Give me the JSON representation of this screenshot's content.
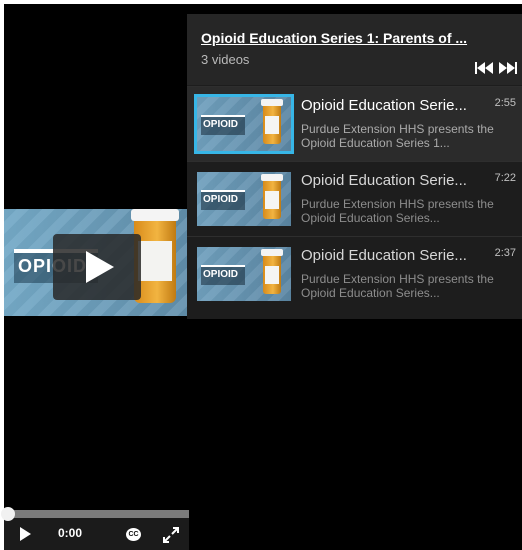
{
  "player": {
    "current_time": "0:00",
    "cc_label": "CC",
    "progress_fraction": 0
  },
  "playlist": {
    "title": "Opioid Education Series 1: Parents of ...",
    "count": "3 videos",
    "items": [
      {
        "title": "Opioid Education Serie...",
        "duration": "2:55",
        "description": "Purdue Extension HHS presents the Opioid Education Series 1...",
        "thumb_text": "OPIOID",
        "active": true
      },
      {
        "title": "Opioid Education Serie...",
        "duration": "7:22",
        "description": "Purdue Extension HHS presents the Opioid Education Series...",
        "thumb_text": "OPIOID",
        "active": false
      },
      {
        "title": "Opioid Education Serie...",
        "duration": "2:37",
        "description": "Purdue Extension HHS presents the Opioid Education Series...",
        "thumb_text": "OPIOID",
        "active": false
      }
    ]
  },
  "video": {
    "thumb_text": "OPIOID"
  },
  "colors": {
    "background": "#000000",
    "playlist_bg": "#1d1d1d",
    "active_thumb_outline": "#37b6e7"
  },
  "icons": {
    "play": "play-icon",
    "prev": "previous-track-icon",
    "next": "next-track-icon",
    "fullscreen": "fullscreen-icon"
  }
}
